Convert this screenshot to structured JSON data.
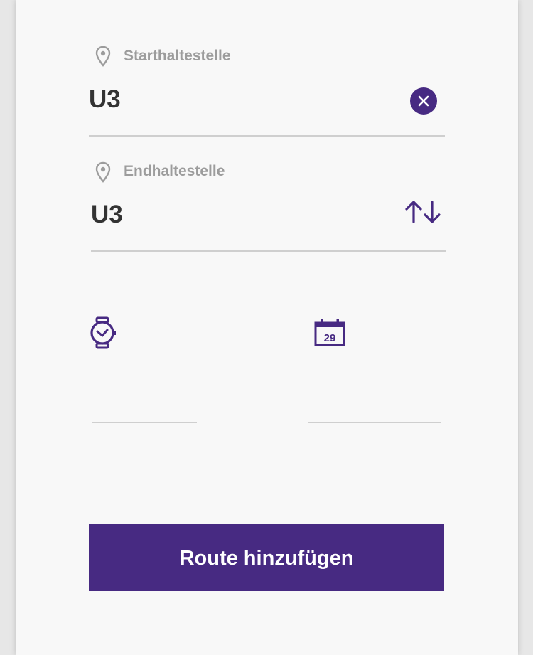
{
  "start": {
    "label": "Starthaltestelle",
    "value": "U3",
    "icon": "location-pin-icon",
    "action_icon": "clear-icon"
  },
  "end": {
    "label": "Endhaltestelle",
    "value": "U3",
    "icon": "location-pin-icon",
    "action_icon": "swap-arrows-icon"
  },
  "time": {
    "icon": "watch-icon",
    "value": ""
  },
  "date": {
    "icon": "calendar-icon",
    "day": "29",
    "value": ""
  },
  "submit": {
    "label": "Route hinzufügen"
  },
  "colors": {
    "accent": "#472a82",
    "label": "#9c9c9c",
    "text": "#333333",
    "divider": "#cfcfcf",
    "background": "#f8f8f8"
  }
}
